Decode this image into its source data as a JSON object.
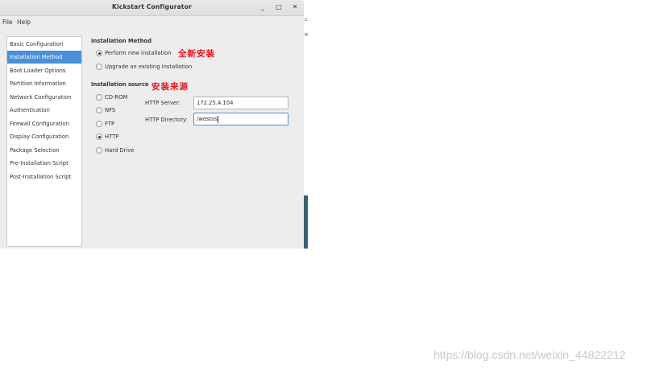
{
  "window": {
    "title": "Kickstart Configurator",
    "controls": {
      "minimize": "_",
      "maximize": "□",
      "close": "✕"
    }
  },
  "menubar": {
    "file": "File",
    "help": "Help"
  },
  "sidebar": {
    "items": [
      {
        "label": "Basic Configuration"
      },
      {
        "label": "Installation Method",
        "selected": true
      },
      {
        "label": "Boot Loader Options"
      },
      {
        "label": "Partition Information"
      },
      {
        "label": "Network Configuration"
      },
      {
        "label": "Authentication"
      },
      {
        "label": "Firewall Configuration"
      },
      {
        "label": "Display Configuration"
      },
      {
        "label": "Package Selection"
      },
      {
        "label": "Pre-Installation Script"
      },
      {
        "label": "Post-Installation Script"
      }
    ]
  },
  "install_method": {
    "title": "Installation Method",
    "annotation": "全新安装",
    "options": [
      {
        "label": "Perform new installation",
        "checked": true
      },
      {
        "label": "Upgrade an existing installation",
        "checked": false
      }
    ]
  },
  "install_source": {
    "title": "Installation source",
    "annotation": "安装来源",
    "options": [
      {
        "label": "CD-ROM",
        "checked": false
      },
      {
        "label": "NFS",
        "checked": false
      },
      {
        "label": "FTP",
        "checked": false
      },
      {
        "label": "HTTP",
        "checked": true
      },
      {
        "label": "Hard Drive",
        "checked": false
      }
    ],
    "http_server": {
      "label": "HTTP Server:",
      "value": "172.25.4.104"
    },
    "http_directory": {
      "label": "HTTP Directory:",
      "value": "/westos"
    }
  },
  "background_strip": {
    "char1": "c",
    "char2": "e"
  },
  "watermark": "https://blog.csdn.net/weixin_44822212",
  "colors": {
    "selection": "#4a90d9",
    "annotation": "#e5131a"
  }
}
